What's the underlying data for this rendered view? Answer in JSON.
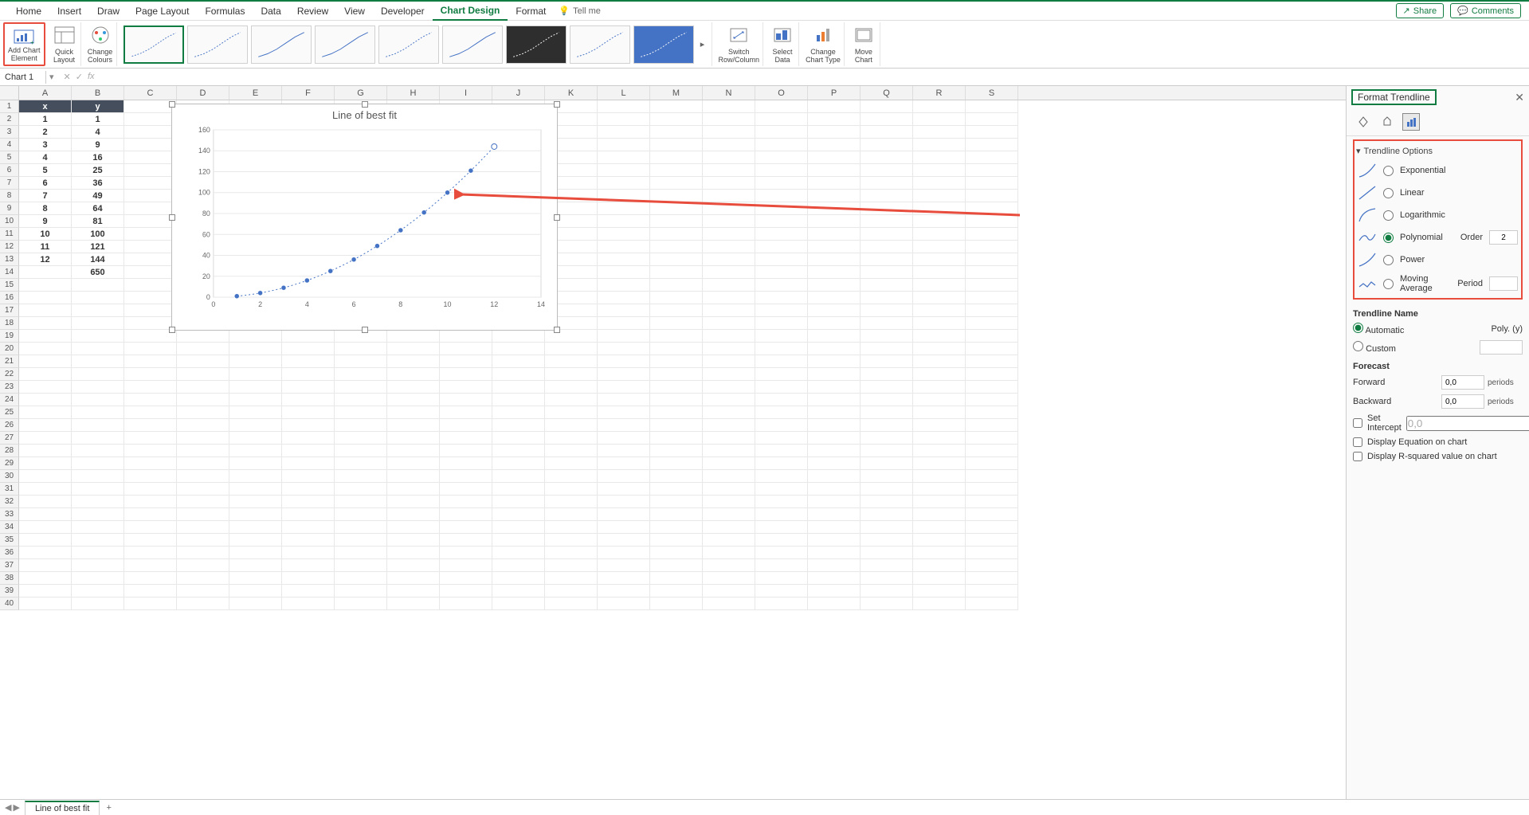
{
  "topTabs": [
    "Home",
    "Insert",
    "Draw",
    "Page Layout",
    "Formulas",
    "Data",
    "Review",
    "View",
    "Developer",
    "Chart Design",
    "Format"
  ],
  "activeTab": "Chart Design",
  "tellMe": "Tell me",
  "share": "Share",
  "comments": "Comments",
  "ribbon": {
    "addChartElement": "Add Chart\nElement",
    "quickLayout": "Quick\nLayout",
    "changeColours": "Change\nColours",
    "switchRowCol": "Switch\nRow/Column",
    "selectData": "Select\nData",
    "changeChartType": "Change\nChart Type",
    "moveChart": "Move\nChart"
  },
  "nameBox": "Chart 1",
  "columns": [
    "A",
    "B",
    "C",
    "D",
    "E",
    "F",
    "G",
    "H",
    "I",
    "J",
    "K",
    "L",
    "M",
    "N",
    "O",
    "P",
    "Q",
    "R",
    "S"
  ],
  "rowCount": 40,
  "data": {
    "headers": {
      "A": "x",
      "B": "y"
    },
    "rows": [
      {
        "A": "1",
        "B": "1"
      },
      {
        "A": "2",
        "B": "4"
      },
      {
        "A": "3",
        "B": "9"
      },
      {
        "A": "4",
        "B": "16"
      },
      {
        "A": "5",
        "B": "25"
      },
      {
        "A": "6",
        "B": "36"
      },
      {
        "A": "7",
        "B": "49"
      },
      {
        "A": "8",
        "B": "64"
      },
      {
        "A": "9",
        "B": "81"
      },
      {
        "A": "10",
        "B": "100"
      },
      {
        "A": "11",
        "B": "121"
      },
      {
        "A": "12",
        "B": "144"
      },
      {
        "A": "",
        "B": "650"
      }
    ]
  },
  "chart_data": {
    "type": "scatter",
    "title": "Line of best fit",
    "xlabel": "",
    "ylabel": "",
    "x": [
      1,
      2,
      3,
      4,
      5,
      6,
      7,
      8,
      9,
      10,
      11,
      12
    ],
    "y": [
      1,
      4,
      9,
      16,
      25,
      36,
      49,
      64,
      81,
      100,
      121,
      144
    ],
    "xlim": [
      0,
      14
    ],
    "ylim": [
      0,
      160
    ],
    "xticks": [
      0,
      2,
      4,
      6,
      8,
      10,
      12,
      14
    ],
    "yticks": [
      0,
      20,
      40,
      60,
      80,
      100,
      120,
      140,
      160
    ],
    "trendline": "polynomial",
    "trendline_order": 2
  },
  "panel": {
    "title": "Format Trendline",
    "sectionOptions": "Trendline Options",
    "options": {
      "exp": "Exponential",
      "lin": "Linear",
      "log": "Logarithmic",
      "poly": "Polynomial",
      "pow": "Power",
      "ma": "Moving Average"
    },
    "orderLabel": "Order",
    "orderValue": "2",
    "periodLabel": "Period",
    "periodValue": "",
    "trendlineName": "Trendline Name",
    "automatic": "Automatic",
    "autoVal": "Poly. (y)",
    "custom": "Custom",
    "customVal": "",
    "forecast": "Forecast",
    "forward": "Forward",
    "forwardVal": "0,0",
    "backward": "Backward",
    "backwardVal": "0,0",
    "periods": "periods",
    "setIntercept": "Set Intercept",
    "setInterceptVal": "0,0",
    "dispEq": "Display Equation on chart",
    "dispR2": "Display R-squared value on chart"
  },
  "sheetTab": "Line of best fit"
}
